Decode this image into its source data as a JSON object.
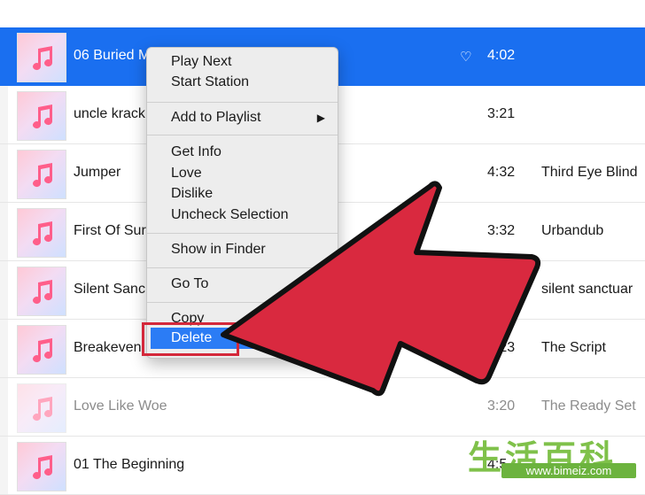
{
  "tracks": [
    {
      "title": "06 Buried M",
      "heart": "♡",
      "time": "4:02",
      "artist": "",
      "state": "selected"
    },
    {
      "title": "uncle krack",
      "heart": "",
      "time": "3:21",
      "artist": "",
      "state": "normal"
    },
    {
      "title": "Jumper",
      "heart": "",
      "time": "4:32",
      "artist": "Third Eye Blind",
      "state": "normal"
    },
    {
      "title": "First Of Sur",
      "heart": "",
      "time": "3:32",
      "artist": "Urbandub",
      "state": "normal"
    },
    {
      "title": "Silent Sanc",
      "heart": "",
      "time": "",
      "artist": "silent sanctuar",
      "state": "normal"
    },
    {
      "title": "Breakeven",
      "heart": "",
      "time": "4:23",
      "artist": "The Script",
      "state": "normal"
    },
    {
      "title": "Love Like Woe",
      "heart": "",
      "time": "3:20",
      "artist": "The Ready Set",
      "state": "dim"
    },
    {
      "title": "01 The Beginning",
      "heart": "",
      "time": "4:5",
      "artist": "",
      "state": "normal"
    }
  ],
  "context_menu": {
    "play_next": "Play Next",
    "start_station": "Start Station",
    "add_to_playlist": "Add to Playlist",
    "submenu_arrow": "▶",
    "get_info": "Get Info",
    "love": "Love",
    "dislike": "Dislike",
    "uncheck_selection": "Uncheck Selection",
    "show_in_finder": "Show in Finder",
    "go_to": "Go To",
    "copy": "Copy",
    "delete": "Delete"
  },
  "annotation": {
    "arrow_color": "#d9293f",
    "arrow_outline": "#111111"
  },
  "watermark": {
    "chars": "生活百科",
    "url": "www.bimeiz.com"
  }
}
